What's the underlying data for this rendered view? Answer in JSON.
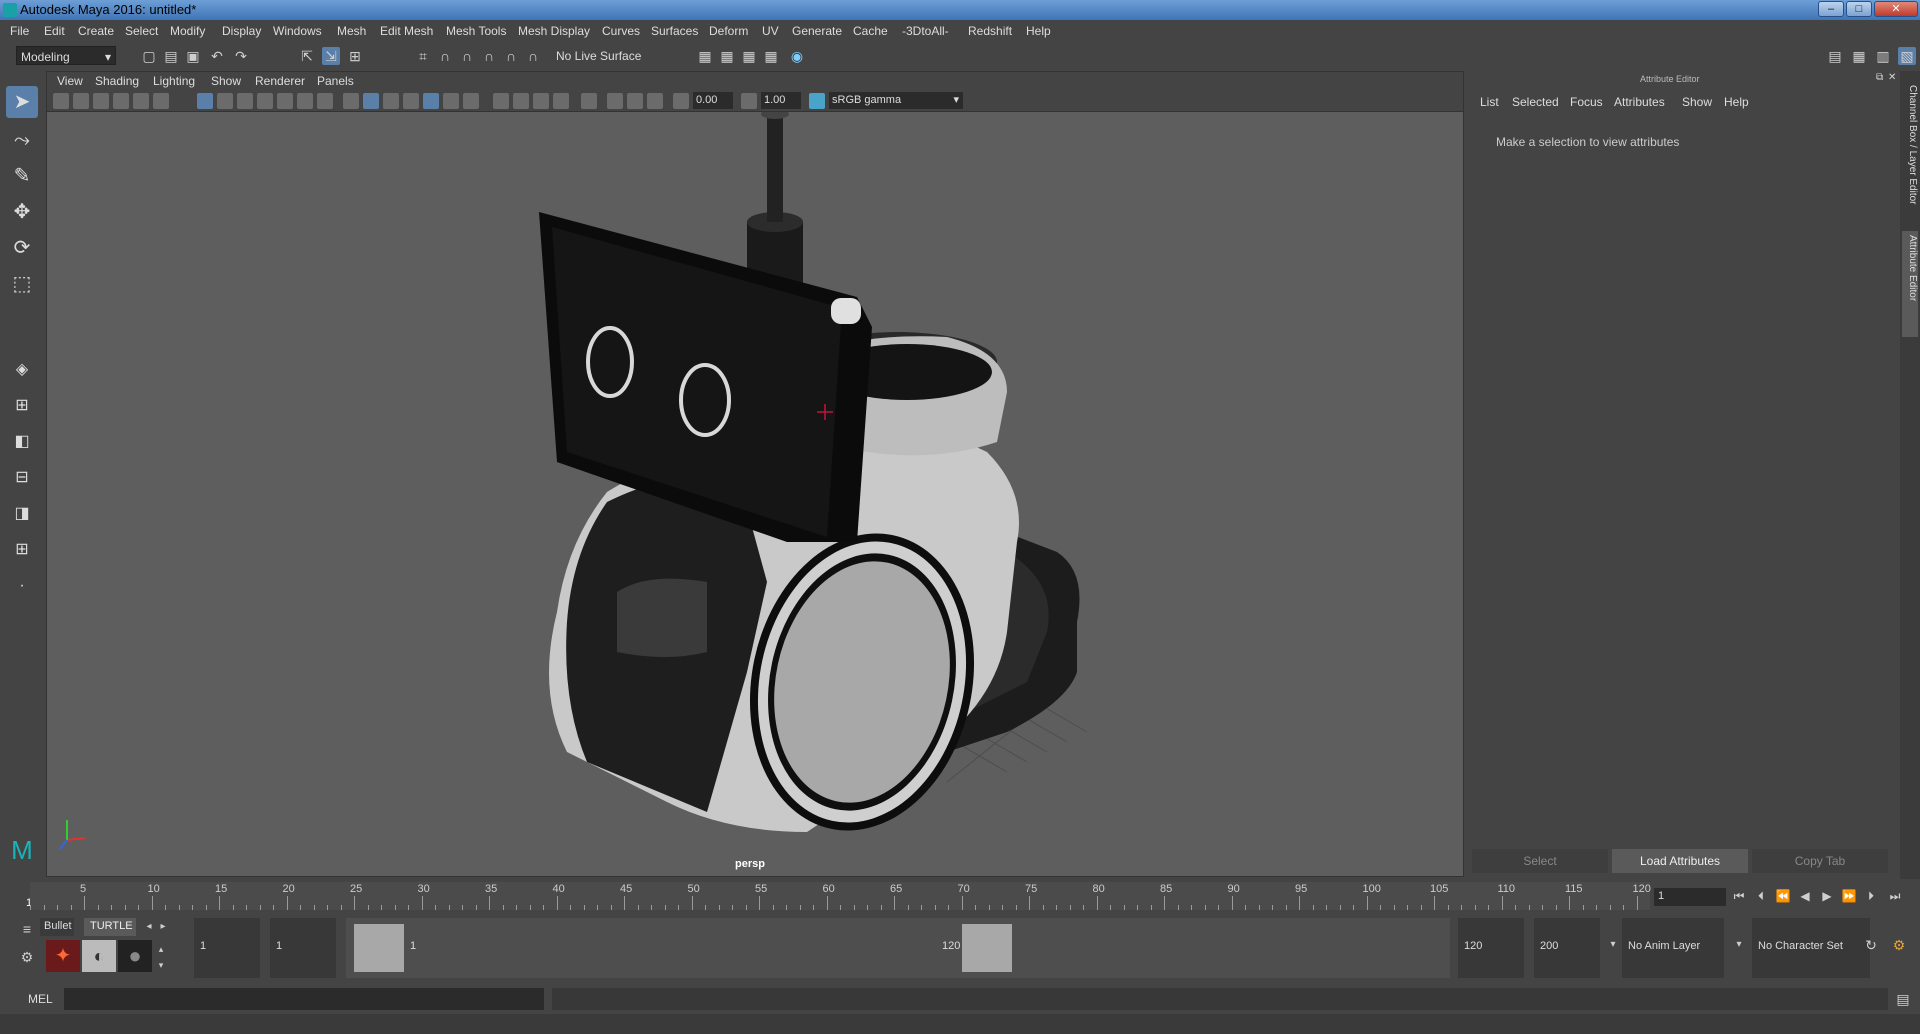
{
  "title": "Autodesk Maya 2016: untitled*",
  "window_buttons": {
    "minimize": "–",
    "maximize": "□",
    "close": "✕"
  },
  "menu": [
    "File",
    "Edit",
    "Create",
    "Select",
    "Modify",
    "Display",
    "Windows",
    "Mesh",
    "Edit Mesh",
    "Mesh Tools",
    "Mesh Display",
    "Curves",
    "Surfaces",
    "Deform",
    "UV",
    "Generate",
    "Cache",
    "-3DtoAll-",
    "Redshift",
    "Help"
  ],
  "shelf": {
    "mode": "Modeling",
    "live_surface": "No Live Surface"
  },
  "viewport": {
    "menu": [
      "View",
      "Shading",
      "Lighting",
      "Show",
      "Renderer",
      "Panels"
    ],
    "exposure": "0.00",
    "gamma": "1.00",
    "color_space": "sRGB gamma",
    "camera_label": "persp"
  },
  "attribute_editor": {
    "header": "Attribute Editor",
    "tabs": [
      "List",
      "Selected",
      "Focus",
      "Attributes",
      "Show",
      "Help"
    ],
    "message": "Make a selection to view attributes",
    "buttons": {
      "select": "Select",
      "load": "Load Attributes",
      "copy": "Copy Tab"
    }
  },
  "side_tabs": {
    "channel_box": "Channel Box / Layer Editor",
    "attribute_editor": "Attribute Editor"
  },
  "timeline": {
    "ticks": [
      "5",
      "10",
      "15",
      "20",
      "25",
      "30",
      "35",
      "40",
      "45",
      "50",
      "55",
      "60",
      "65",
      "70",
      "75",
      "80",
      "85",
      "90",
      "95",
      "100",
      "105",
      "110",
      "115",
      "120"
    ],
    "start_label": "1",
    "current_frame": "1"
  },
  "range": {
    "shelf_tabs": [
      "Bullet",
      "TURTLE"
    ],
    "start": "1",
    "start2": "1",
    "slider_start": "1",
    "slider_end": "120",
    "end": "120",
    "end2": "200",
    "anim_layer": "No Anim Layer",
    "char_set": "No Character Set"
  },
  "cmdline": {
    "label": "MEL"
  }
}
